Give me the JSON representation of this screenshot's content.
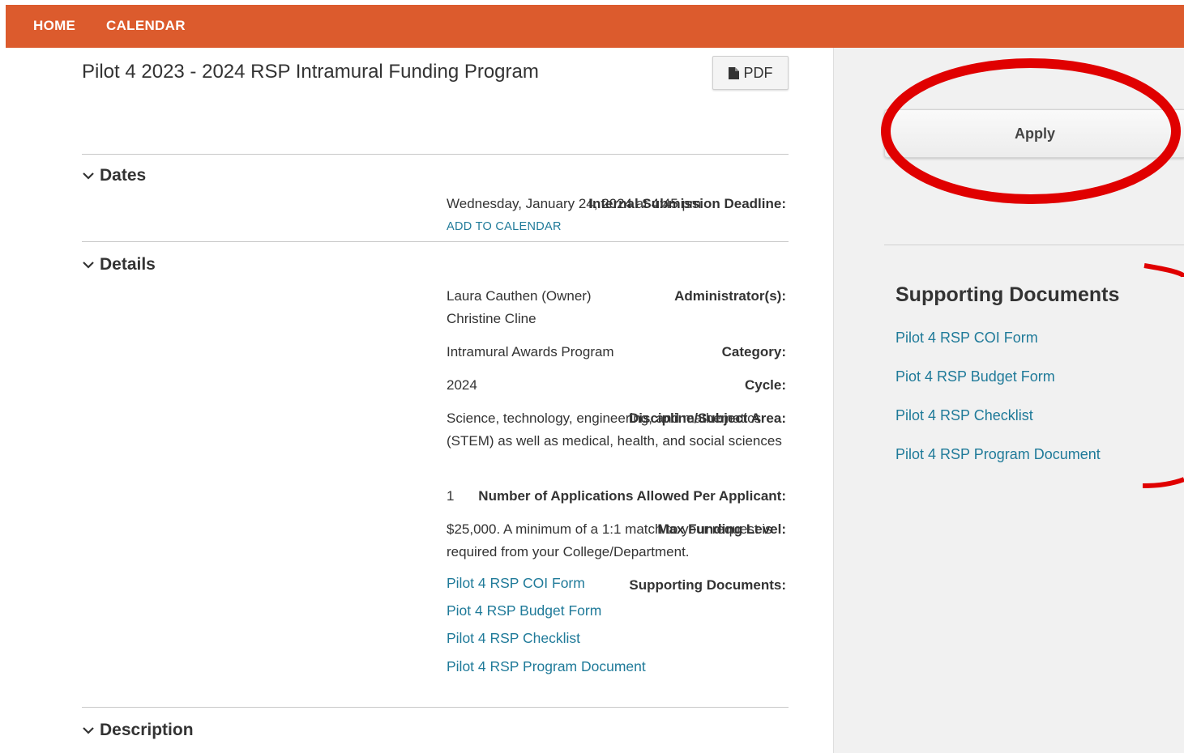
{
  "nav": {
    "home": "HOME",
    "calendar": "CALENDAR"
  },
  "program": {
    "title": "Pilot 4 2023 - 2024 RSP Intramural Funding Program",
    "pdf_label": "PDF"
  },
  "sections": {
    "dates": "Dates",
    "details": "Details",
    "description": "Description"
  },
  "dates": {
    "deadline_label": "Internal Submission Deadline:",
    "deadline_value": "Wednesday, January 24, 2024 at 4:45 pm",
    "add_to_calendar": "ADD TO CALENDAR"
  },
  "details": {
    "administrators_label": "Administrator(s):",
    "administrators": [
      "Laura Cauthen (Owner)",
      "Christine Cline"
    ],
    "category_label": "Category:",
    "category": "Intramural Awards Program",
    "cycle_label": "Cycle:",
    "cycle": "2024",
    "discipline_label": "Discipline/Subject Area:",
    "discipline": "Science, technology, engineering, and mathematics (STEM) as well as medical, health, and social sciences",
    "num_apps_label": "Number of Applications Allowed Per Applicant:",
    "num_apps": "1",
    "max_funding_label": "Max Funding Level:",
    "max_funding": "$25,000. A minimum of a 1:1 match to your request is required from your College/Department.",
    "supporting_label": "Supporting Documents:",
    "documents": [
      "Pilot 4 RSP COI Form",
      "Piot 4 RSP Budget Form",
      "Pilot 4 RSP Checklist",
      "Pilot 4 RSP Program Document"
    ]
  },
  "sidebar": {
    "apply_label": "Apply",
    "heading": "Supporting Documents",
    "documents": [
      "Pilot 4 RSP COI Form",
      "Piot 4 RSP Budget Form",
      "Pilot 4 RSP Checklist",
      "Pilot 4 RSP Program Document"
    ]
  },
  "colors": {
    "topbar": "#dc5b2d",
    "link": "#1f7a99",
    "annotation": "#e00000",
    "sidebar_bg": "#f1f1f1"
  },
  "icons": [
    "file-icon",
    "chevron-down-icon"
  ]
}
